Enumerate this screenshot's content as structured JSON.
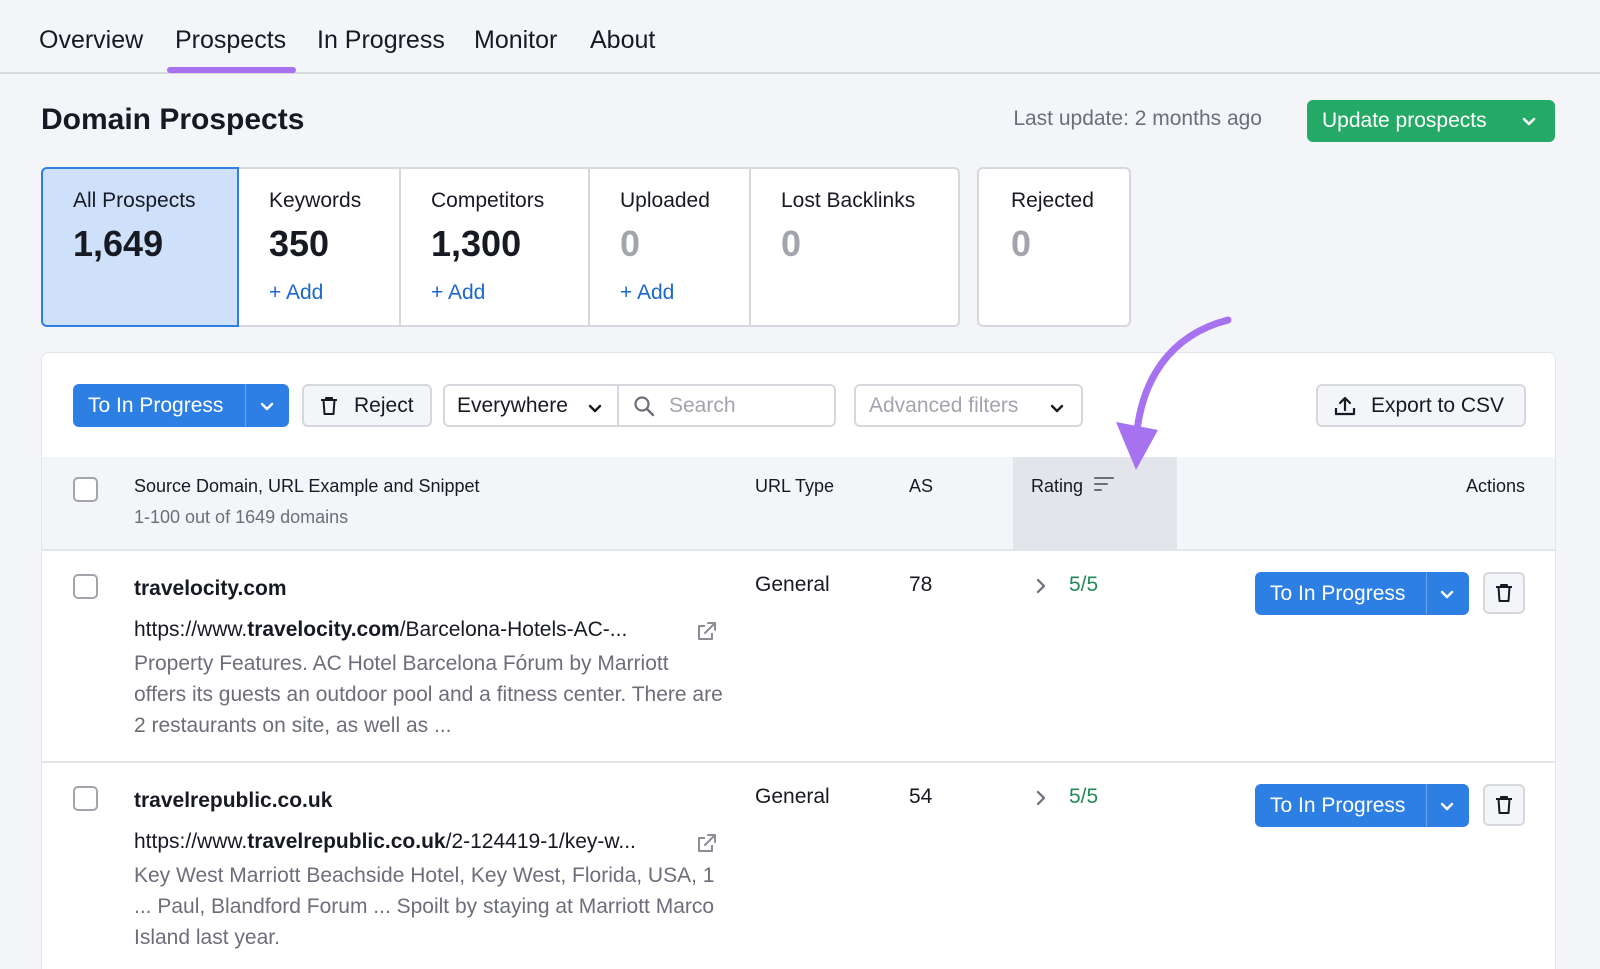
{
  "nav": {
    "tabs": [
      {
        "label": "Overview"
      },
      {
        "label": "Prospects"
      },
      {
        "label": "In Progress"
      },
      {
        "label": "Monitor"
      },
      {
        "label": "About"
      }
    ],
    "active_tab": "Prospects"
  },
  "header": {
    "title": "Domain Prospects",
    "last_update": "Last update: 2 months ago",
    "update_button": "Update prospects"
  },
  "cards": [
    {
      "label": "All Prospects",
      "value": "1,649"
    },
    {
      "label": "Keywords",
      "value": "350",
      "add": "+ Add"
    },
    {
      "label": "Competitors",
      "value": "1,300",
      "add": "+ Add"
    },
    {
      "label": "Uploaded",
      "value": "0",
      "add": "+ Add"
    },
    {
      "label": "Lost Backlinks",
      "value": "0"
    },
    {
      "label": "Rejected",
      "value": "0"
    }
  ],
  "toolbar": {
    "to_in_progress": "To In Progress",
    "reject": "Reject",
    "scope": "Everywhere",
    "search_placeholder": "Search",
    "advanced_filters": "Advanced filters",
    "export": "Export to CSV"
  },
  "table": {
    "col_source": "Source Domain, URL Example and Snippet",
    "col_source_sub": "1-100 out of 1649 domains",
    "col_url_type": "URL Type",
    "col_as": "AS",
    "col_rating": "Rating",
    "col_actions": "Actions",
    "rows": [
      {
        "domain": "travelocity.com",
        "url_prefix": "https://www.",
        "url_domain": "travelocity.com",
        "url_suffix": "/Barcelona-Hotels-AC-...",
        "snippet": "Property Features. AC Hotel Barcelona Fórum by Marriott offers its guests an outdoor pool and a fitness center. There are 2 restaurants on site, as well as ...",
        "url_type": "General",
        "as": "78",
        "rating": "5/5",
        "action": "To In Progress"
      },
      {
        "domain": "travelrepublic.co.uk",
        "url_prefix": "https://www.",
        "url_domain": "travelrepublic.co.uk",
        "url_suffix": "/2-124419-1/key-w...",
        "snippet": "Key West Marriott Beachside Hotel, Key West, Florida, USA, 1 ... Paul, Blandford Forum ... Spoilt by staying at Marriott Marco Island last year.",
        "url_type": "General",
        "as": "54",
        "rating": "5/5",
        "action": "To In Progress"
      }
    ]
  },
  "colors": {
    "accent_purple": "#a772f0",
    "primary_blue": "#2e7fe4",
    "green": "#25a966",
    "link_blue": "#1c68c9"
  }
}
